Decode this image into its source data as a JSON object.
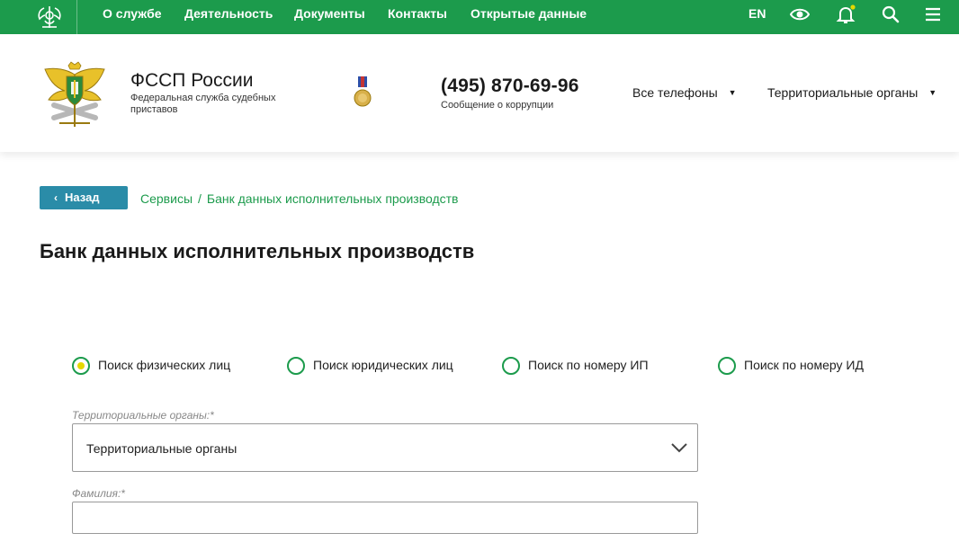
{
  "topnav": {
    "menu": [
      {
        "label": "О службе"
      },
      {
        "label": "Деятельность"
      },
      {
        "label": "Документы"
      },
      {
        "label": "Контакты"
      },
      {
        "label": "Открытые данные"
      }
    ],
    "lang": "EN",
    "icons": [
      "eye-icon",
      "bell-icon",
      "search-icon",
      "menu-icon"
    ],
    "notification_dot_color": "#e6d800"
  },
  "header": {
    "title": "ФССП России",
    "subtitle": "Федеральная служба судебных приставов",
    "phone": "(495) 870-69-96",
    "phone_caption": "Сообщение о коррупции",
    "dropdowns": [
      {
        "label": "Все телефоны"
      },
      {
        "label": "Территориальные органы"
      }
    ]
  },
  "nav": {
    "back_label": "Назад",
    "breadcrumbs": [
      "Сервисы",
      "Банк данных исполнительных производств"
    ]
  },
  "page_title": "Банк данных исполнительных производств",
  "search_modes": [
    {
      "label": "Поиск физических лиц",
      "selected": true
    },
    {
      "label": "Поиск юридических лиц",
      "selected": false
    },
    {
      "label": "Поиск по номеру ИП",
      "selected": false
    },
    {
      "label": "Поиск по номеру ИД",
      "selected": false
    }
  ],
  "form": {
    "territory_label": "Территориальные органы:*",
    "territory_value": "Территориальные органы",
    "surname_label": "Фамилия:*",
    "surname_value": ""
  },
  "colors": {
    "brand_green": "#1c9b4c",
    "back_button": "#2a8ca8",
    "radio_selected_dot": "#e6d800"
  }
}
